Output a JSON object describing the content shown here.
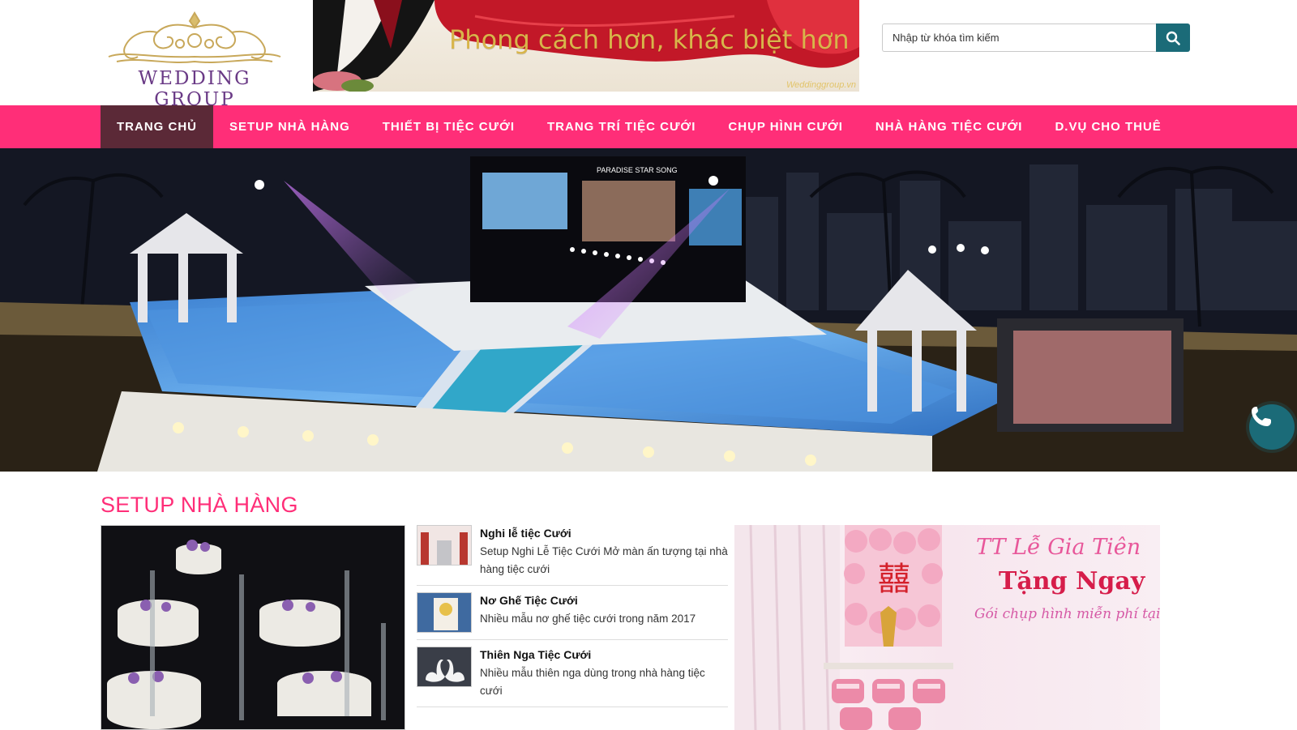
{
  "logo": {
    "text": "WEDDING GROUP"
  },
  "banner": {
    "slogan": "Phong cách hơn, khác biệt hơn ...",
    "watermark": "Weddinggroup.vn"
  },
  "search": {
    "placeholder": "Nhập từ khóa tìm kiếm",
    "icon": "search-icon"
  },
  "nav": {
    "items": [
      {
        "label": "TRANG CHỦ",
        "active": true
      },
      {
        "label": "SETUP NHÀ HÀNG"
      },
      {
        "label": "THIẾT BỊ TIỆC CƯỚI"
      },
      {
        "label": "TRANG TRÍ TIỆC CƯỚI"
      },
      {
        "label": "CHỤP HÌNH CƯỚI"
      },
      {
        "label": "NHÀ HÀNG TIỆC CƯỚI"
      },
      {
        "label": "D.VỤ CHO THUÊ"
      }
    ]
  },
  "hero": {
    "stage_sign": "PARADISE STAR SONG"
  },
  "phone_button": {
    "icon": "phone-icon"
  },
  "section": {
    "title": "SETUP NHÀ HÀNG",
    "articles": [
      {
        "title": "Nghi lễ tiệc Cưới",
        "desc": "Setup Nghi Lễ Tiệc Cưới Mở màn ấn tượng tại nhà hàng tiệc cưới"
      },
      {
        "title": "Nơ Ghế Tiệc Cưới",
        "desc": "Nhiều mẫu nơ ghế tiệc cưới trong năm 2017"
      },
      {
        "title": "Thiên Nga Tiệc Cưới",
        "desc": "Nhiều mẫu thiên nga dùng trong nhà hàng tiệc cưới"
      }
    ]
  },
  "promo": {
    "line1": "TT Lễ Gia Tiên",
    "line2": "Tặng Ngay",
    "line3": "Gói chụp hình miễn phí tại nhà",
    "symbol": "囍"
  },
  "colors": {
    "nav_bg": "#ff2e78",
    "nav_active": "#5b2937",
    "accent": "#1b6b78",
    "section_title": "#ff2e78"
  }
}
